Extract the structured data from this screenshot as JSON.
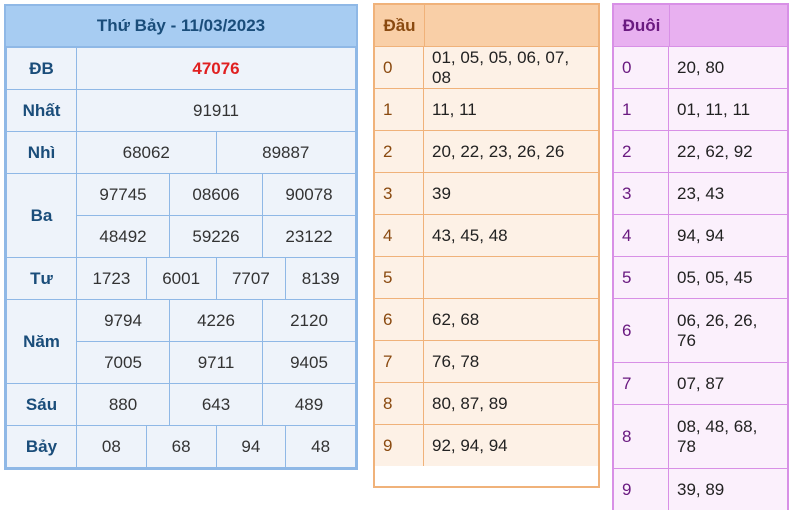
{
  "results": {
    "title": "Thứ Bảy - 11/03/2023",
    "db": {
      "label": "ĐB",
      "values": [
        "47076"
      ]
    },
    "nhat": {
      "label": "Nhất",
      "values": [
        "91911"
      ]
    },
    "nhi": {
      "label": "Nhì",
      "values": [
        "68062",
        "89887"
      ]
    },
    "ba": {
      "label": "Ba",
      "values": [
        "97745",
        "08606",
        "90078",
        "48492",
        "59226",
        "23122"
      ]
    },
    "tu": {
      "label": "Tư",
      "values": [
        "1723",
        "6001",
        "7707",
        "8139"
      ]
    },
    "nam": {
      "label": "Năm",
      "values": [
        "9794",
        "4226",
        "2120",
        "7005",
        "9711",
        "9405"
      ]
    },
    "sau": {
      "label": "Sáu",
      "values": [
        "880",
        "643",
        "489"
      ]
    },
    "bay": {
      "label": "Bảy",
      "values": [
        "08",
        "68",
        "94",
        "48"
      ]
    }
  },
  "head": {
    "header": "Đầu",
    "rows": [
      {
        "key": "0",
        "value": "01, 05, 05, 06, 07, 08"
      },
      {
        "key": "1",
        "value": "11, 11"
      },
      {
        "key": "2",
        "value": "20, 22, 23, 26, 26"
      },
      {
        "key": "3",
        "value": "39"
      },
      {
        "key": "4",
        "value": "43, 45, 48"
      },
      {
        "key": "5",
        "value": ""
      },
      {
        "key": "6",
        "value": "62, 68"
      },
      {
        "key": "7",
        "value": "76, 78"
      },
      {
        "key": "8",
        "value": "80, 87, 89"
      },
      {
        "key": "9",
        "value": "92, 94, 94"
      }
    ]
  },
  "tail": {
    "header": "Đuôi",
    "rows": [
      {
        "key": "0",
        "value": "20, 80"
      },
      {
        "key": "1",
        "value": "01, 11, 11"
      },
      {
        "key": "2",
        "value": "22, 62, 92"
      },
      {
        "key": "3",
        "value": "23, 43"
      },
      {
        "key": "4",
        "value": "94, 94"
      },
      {
        "key": "5",
        "value": "05, 05, 45"
      },
      {
        "key": "6",
        "value": "06, 26, 26, 76"
      },
      {
        "key": "7",
        "value": "07, 87"
      },
      {
        "key": "8",
        "value": "08, 48, 68, 78"
      },
      {
        "key": "9",
        "value": "39, 89"
      }
    ]
  },
  "colors": {
    "results_header_bg": "#a7ccf2",
    "results_border": "#8fb8e6",
    "special_prize": "#e02020",
    "head_header_bg": "#f9cfa7",
    "head_border": "#f0b27a",
    "tail_header_bg": "#e8b0f0",
    "tail_border": "#d890e6"
  }
}
